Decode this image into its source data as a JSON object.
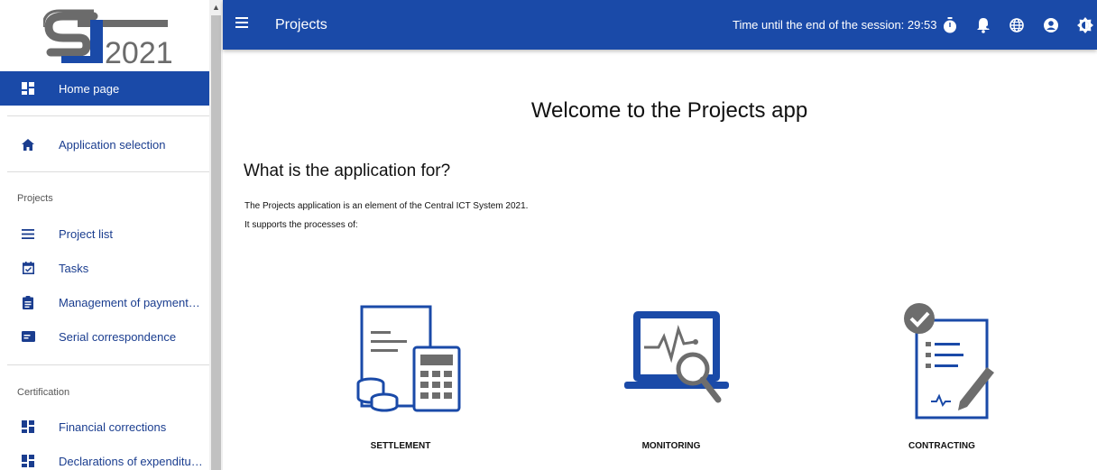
{
  "logo": {
    "text": "2021",
    "alt_letters": "ST"
  },
  "sidebar": {
    "home": {
      "label": "Home page",
      "icon": "dashboard-icon"
    },
    "app_selection": {
      "label": "Application selection",
      "icon": "home-icon"
    },
    "sections": [
      {
        "title": "Projects",
        "items": [
          {
            "label": "Project list",
            "icon": "list-icon"
          },
          {
            "label": "Tasks",
            "icon": "calendar-check-icon"
          },
          {
            "label": "Management of payment…",
            "icon": "clipboard-icon"
          },
          {
            "label": "Serial correspondence",
            "icon": "mail-card-icon"
          }
        ]
      },
      {
        "title": "Certification",
        "items": [
          {
            "label": "Financial corrections",
            "icon": "dashboard-icon"
          },
          {
            "label": "Declarations of expenditu…",
            "icon": "dashboard-icon"
          }
        ]
      }
    ]
  },
  "topbar": {
    "title": "Projects",
    "session_text": "Time until the end of the session: 29:53"
  },
  "main": {
    "welcome": "Welcome to the Projects app",
    "heading": "What is the application for?",
    "paragraph1": "The Projects application is an element of the Central ICT System 2021.",
    "paragraph2": "It supports the processes of:",
    "features": [
      {
        "label": "SETTLEMENT",
        "icon": "calculator-documents-icon"
      },
      {
        "label": "MONITORING",
        "icon": "laptop-monitoring-icon"
      },
      {
        "label": "CONTRACTING",
        "icon": "contract-sign-icon"
      }
    ]
  },
  "colors": {
    "primary": "#1a4aa8",
    "icon_gray": "#6d6d6d"
  }
}
